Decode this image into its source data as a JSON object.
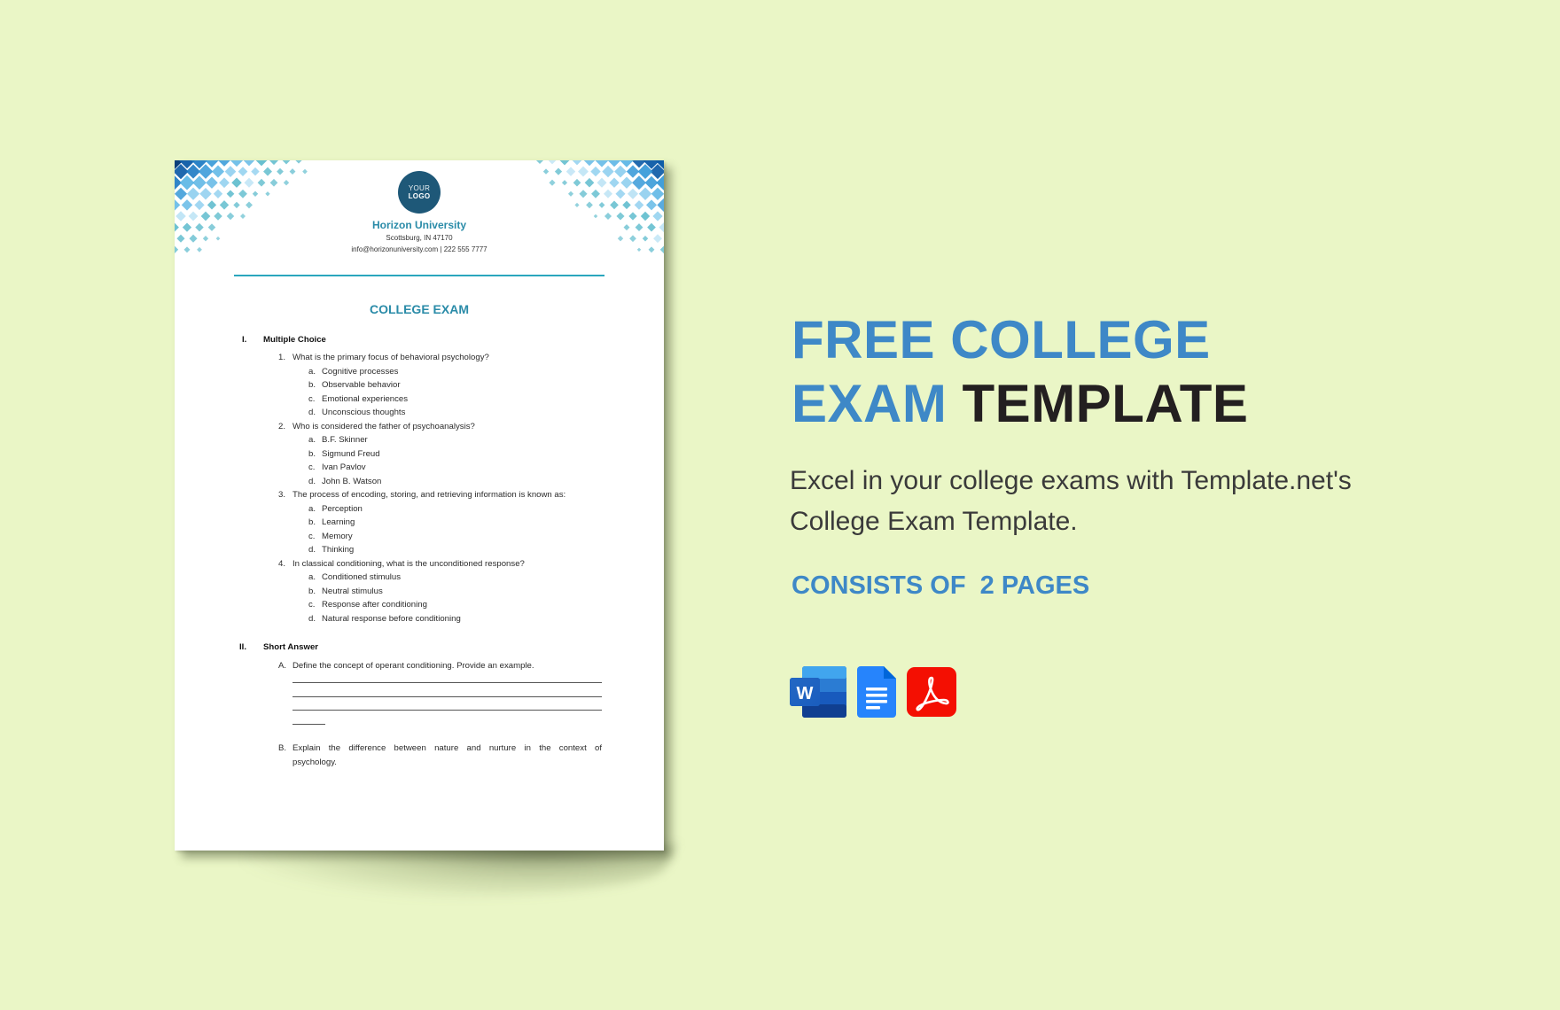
{
  "document": {
    "logo": {
      "line1": "YOUR",
      "line2": "LOGO"
    },
    "institution": {
      "name": "Horizon University",
      "address": "Scottsburg, IN 47170",
      "contact": "info@horizonuniversity.com | 222 555 7777"
    },
    "title": "COLLEGE EXAM",
    "sections": [
      {
        "numeral": "I.",
        "title": "Multiple Choice",
        "questions": [
          {
            "num": "1.",
            "text": "What is the primary focus of behavioral psychology?",
            "options": [
              {
                "letter": "a.",
                "text": "Cognitive processes"
              },
              {
                "letter": "b.",
                "text": "Observable behavior"
              },
              {
                "letter": "c.",
                "text": "Emotional experiences"
              },
              {
                "letter": "d.",
                "text": "Unconscious thoughts"
              }
            ]
          },
          {
            "num": "2.",
            "text": "Who is considered the father of psychoanalysis?",
            "options": [
              {
                "letter": "a.",
                "text": "B.F. Skinner"
              },
              {
                "letter": "b.",
                "text": "Sigmund Freud"
              },
              {
                "letter": "c.",
                "text": "Ivan Pavlov"
              },
              {
                "letter": "d.",
                "text": "John B. Watson"
              }
            ]
          },
          {
            "num": "3.",
            "text": "The process of encoding, storing, and retrieving information is known as:",
            "options": [
              {
                "letter": "a.",
                "text": "Perception"
              },
              {
                "letter": "b.",
                "text": "Learning"
              },
              {
                "letter": "c.",
                "text": "Memory"
              },
              {
                "letter": "d.",
                "text": "Thinking"
              }
            ]
          },
          {
            "num": "4.",
            "text": "In classical conditioning, what is the unconditioned response?",
            "options": [
              {
                "letter": "a.",
                "text": "Conditioned stimulus"
              },
              {
                "letter": "b.",
                "text": "Neutral stimulus"
              },
              {
                "letter": "c.",
                "text": "Response after conditioning"
              },
              {
                "letter": "d.",
                "text": "Natural response before conditioning"
              }
            ]
          }
        ]
      },
      {
        "numeral": "II.",
        "title": "Short Answer",
        "questions": [
          {
            "num": "A.",
            "text": "Define the concept of operant conditioning. Provide an example."
          },
          {
            "num": "B.",
            "text_line1": "Explain the difference between nature and nurture in the context of",
            "text_line2": "psychology."
          }
        ]
      }
    ]
  },
  "hero": {
    "title_blue_1": "FREE COLLEGE",
    "title_blue_2": "EXAM",
    "title_dark": "TEMPLATE",
    "description_line1": "Excel in your college exams with Template.net's",
    "description_line2": "College Exam Template.",
    "pages_label": "CONSISTS OF  2 PAGES",
    "formats": [
      {
        "name": "Microsoft Word",
        "icon": "word-icon",
        "letter": "W"
      },
      {
        "name": "Google Docs",
        "icon": "google-docs-icon"
      },
      {
        "name": "Adobe PDF",
        "icon": "pdf-icon"
      }
    ]
  },
  "colors": {
    "background": "#EAF6C6",
    "accent_blue": "#3E88C7",
    "document_teal": "#2A8BA8",
    "logo_navy": "#1E5878",
    "title_dark": "#231F20"
  }
}
